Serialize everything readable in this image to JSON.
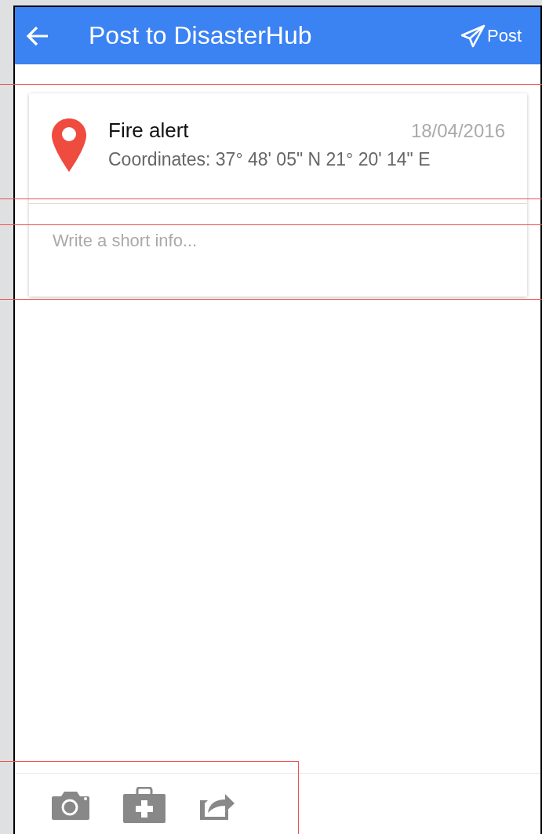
{
  "app_bar": {
    "title": "Post to DisasterHub",
    "action": "Post"
  },
  "alert": {
    "title": "Fire alert",
    "date": "18/04/2016",
    "coordinates": "Coordinates: 37° 48' 05\" N 21° 20' 14\" E"
  },
  "info_field": {
    "placeholder": "Write a short info..."
  }
}
